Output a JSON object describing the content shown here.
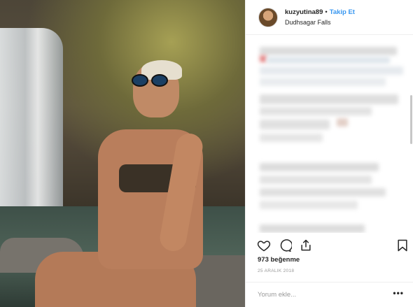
{
  "header": {
    "username": "kuzyutina89",
    "separator": "•",
    "follow_label": "Takip Et",
    "location": "Dudhsagar Falls"
  },
  "actions": {
    "icons": [
      "heart-icon",
      "comment-icon",
      "share-icon",
      "bookmark-icon"
    ]
  },
  "likes_label": "973 beğenme",
  "date_label": "25 ARALIK 2018",
  "comment_bar": {
    "placeholder": "Yorum ekle...",
    "more_label": "•••"
  },
  "colors": {
    "link": "#3897f0",
    "border": "#efefef",
    "text": "#262626",
    "muted": "#999999"
  }
}
